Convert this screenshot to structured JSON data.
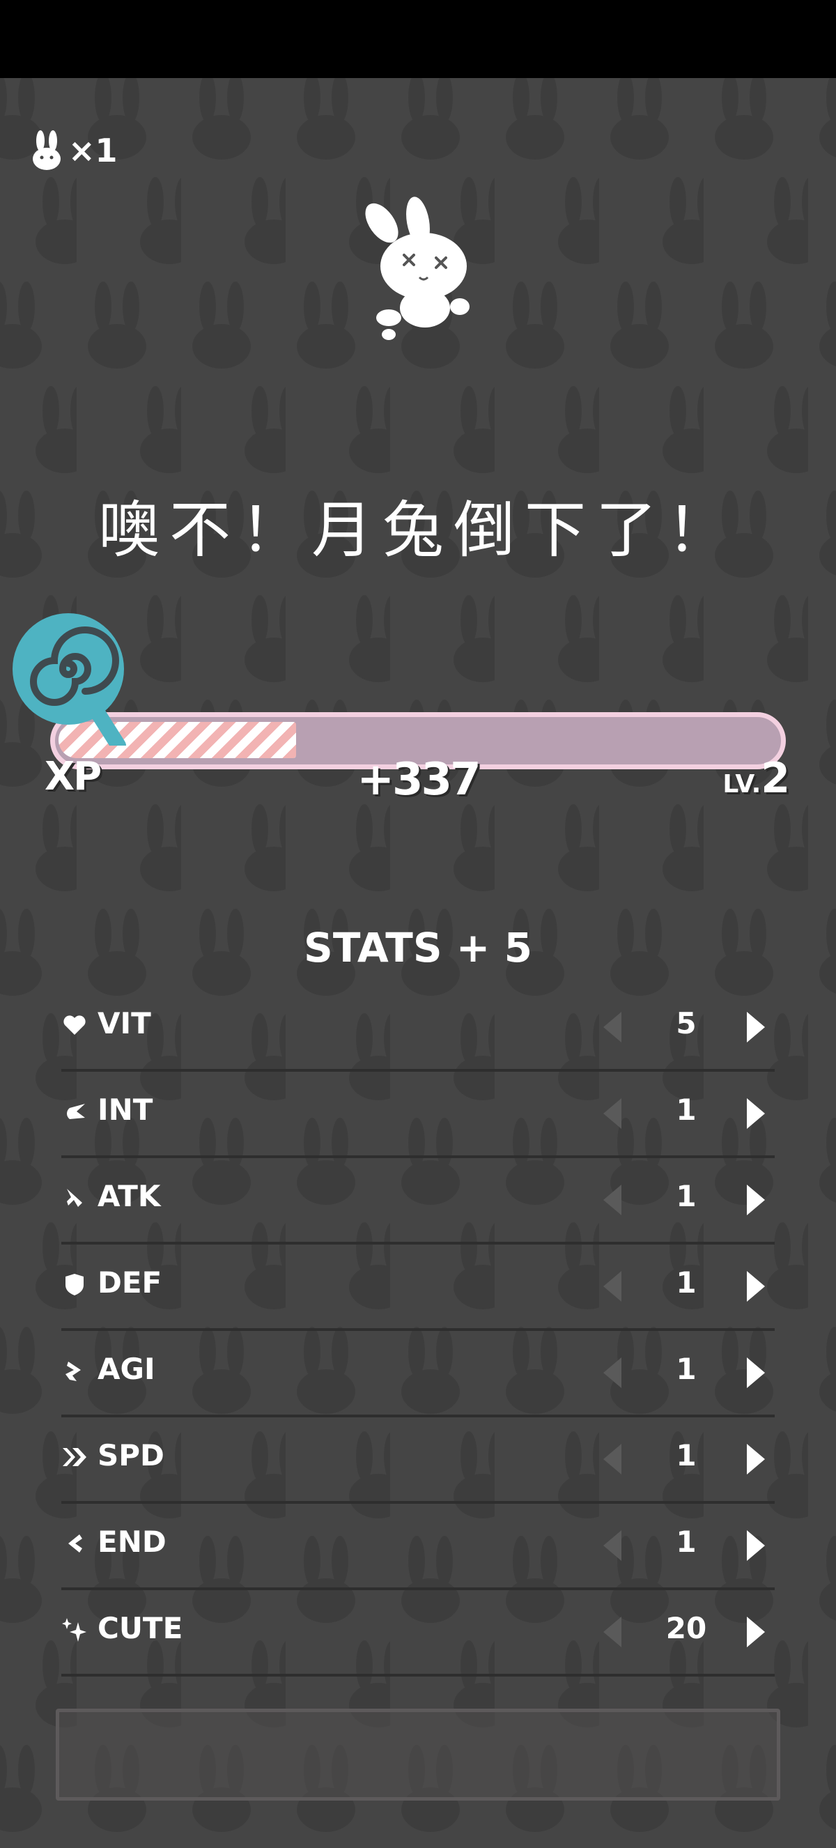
{
  "header": {
    "lives_count": "×1"
  },
  "main": {
    "headline": "噢不！月兔倒下了！",
    "xp": {
      "label": "XP",
      "gain": "+337",
      "level_prefix": "LV.",
      "level_value": "2",
      "fill_fraction": 0.33
    },
    "stats": {
      "title": "STATS + 5",
      "items": [
        {
          "name": "VIT",
          "value": "5",
          "icon": "heart-icon"
        },
        {
          "name": "INT",
          "value": "1",
          "icon": "brain-icon"
        },
        {
          "name": "ATK",
          "value": "1",
          "icon": "sword-icon"
        },
        {
          "name": "DEF",
          "value": "1",
          "icon": "shield-icon"
        },
        {
          "name": "AGI",
          "value": "1",
          "icon": "agility-icon"
        },
        {
          "name": "SPD",
          "value": "1",
          "icon": "speed-icon"
        },
        {
          "name": "END",
          "value": "1",
          "icon": "endurance-icon"
        },
        {
          "name": "CUTE",
          "value": "20",
          "icon": "sparkle-icon"
        }
      ]
    }
  },
  "colors": {
    "background": "#454545",
    "xp_bar_border": "#f3d0e0",
    "xp_bar_track": "#b8a0b2",
    "xp_stripe": "#f2b3b3",
    "lollipop": "#4eb3c2"
  }
}
